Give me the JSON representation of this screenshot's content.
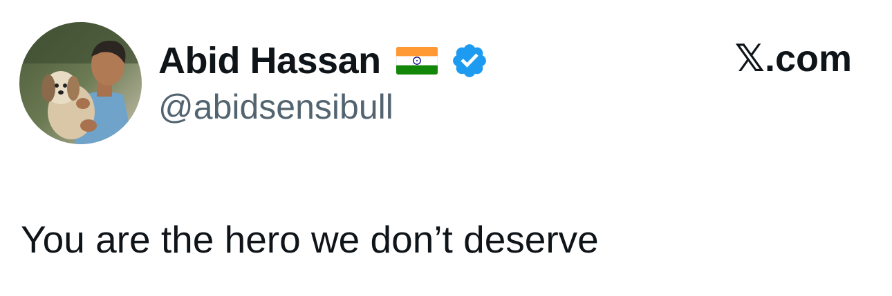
{
  "author": {
    "display_name": "Abid Hassan",
    "handle": "@abidsensibull",
    "flag_icon": "india-flag-icon",
    "verified_icon": "verified-badge-icon",
    "avatar_icon": "profile-photo-man-with-dog"
  },
  "brand": {
    "logo_glyph": "𝕏",
    "domain_suffix": ".com"
  },
  "tweet": {
    "text": "You are the hero we don’t deserve"
  },
  "colors": {
    "text_primary": "#0f1419",
    "text_secondary": "#536471",
    "verified_blue": "#1d9bf0",
    "flag_saffron": "#ff9933",
    "flag_green": "#138808",
    "flag_chakra": "#000080"
  }
}
